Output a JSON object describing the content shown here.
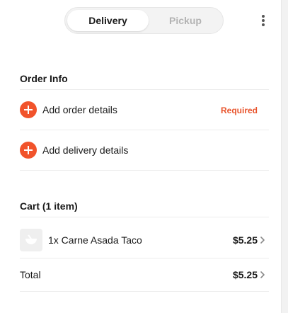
{
  "mode_toggle": {
    "delivery_label": "Delivery",
    "pickup_label": "Pickup",
    "selected": "Delivery"
  },
  "order_info": {
    "title": "Order Info",
    "order_details_label": "Add order details",
    "order_details_status": "Required",
    "delivery_details_label": "Add delivery details"
  },
  "cart": {
    "title": "Cart (1 item)",
    "items": [
      {
        "quantity_name": "1x Carne Asada Taco",
        "price": "$5.25"
      }
    ],
    "total_label": "Total",
    "total_value": "$5.25"
  },
  "colors": {
    "accent": "#f1532b",
    "required_text": "#e8532b"
  },
  "icons": [
    "kebab-menu-icon",
    "plus-icon",
    "food-thumbnail-icon",
    "chevron-right-icon"
  ]
}
